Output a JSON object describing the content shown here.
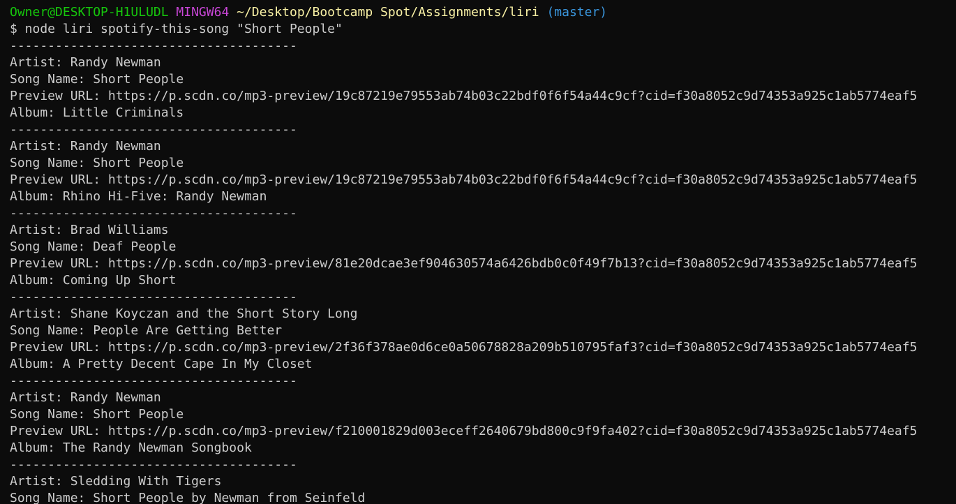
{
  "prompt": {
    "user_host": "Owner@DESKTOP-H1ULUDL",
    "env": "MINGW64",
    "path": "~/Desktop/Bootcamp Spot/Assignments/liri",
    "branch": "(master)"
  },
  "command": "$ node liri spotify-this-song \"Short People\"",
  "separator": "--------------------------------------",
  "labels": {
    "artist": "Artist: ",
    "song": "Song Name: ",
    "preview": "Preview URL: ",
    "album": "Album: "
  },
  "results": [
    {
      "artist": "Randy Newman",
      "song": "Short People",
      "preview": "https://p.scdn.co/mp3-preview/19c87219e79553ab74b03c22bdf0f6f54a44c9cf?cid=f30a8052c9d74353a925c1ab5774eaf5",
      "album": "Little Criminals"
    },
    {
      "artist": "Randy Newman",
      "song": "Short People",
      "preview": "https://p.scdn.co/mp3-preview/19c87219e79553ab74b03c22bdf0f6f54a44c9cf?cid=f30a8052c9d74353a925c1ab5774eaf5",
      "album": "Rhino Hi-Five: Randy Newman"
    },
    {
      "artist": "Brad Williams",
      "song": "Deaf People",
      "preview": "https://p.scdn.co/mp3-preview/81e20dcae3ef904630574a6426bdb0c0f49f7b13?cid=f30a8052c9d74353a925c1ab5774eaf5",
      "album": "Coming Up Short"
    },
    {
      "artist": "Shane Koyczan and the Short Story Long",
      "song": "People Are Getting Better",
      "preview": "https://p.scdn.co/mp3-preview/2f36f378ae0d6ce0a50678828a209b510795faf3?cid=f30a8052c9d74353a925c1ab5774eaf5",
      "album": "A Pretty Decent Cape In My Closet"
    },
    {
      "artist": "Randy Newman",
      "song": "Short People",
      "preview": "https://p.scdn.co/mp3-preview/f210001829d003eceff2640679bd800c9f9fa402?cid=f30a8052c9d74353a925c1ab5774eaf5",
      "album": "The Randy Newman Songbook"
    },
    {
      "artist": "Sledding With Tigers",
      "song": "Short People by Newman from Seinfeld"
    }
  ],
  "colors": {
    "background": "#0c0c0c",
    "text": "#cccccc",
    "user_host": "#16c60c",
    "env": "#c846d6",
    "path": "#f9f1a5",
    "branch": "#3a96dd"
  }
}
